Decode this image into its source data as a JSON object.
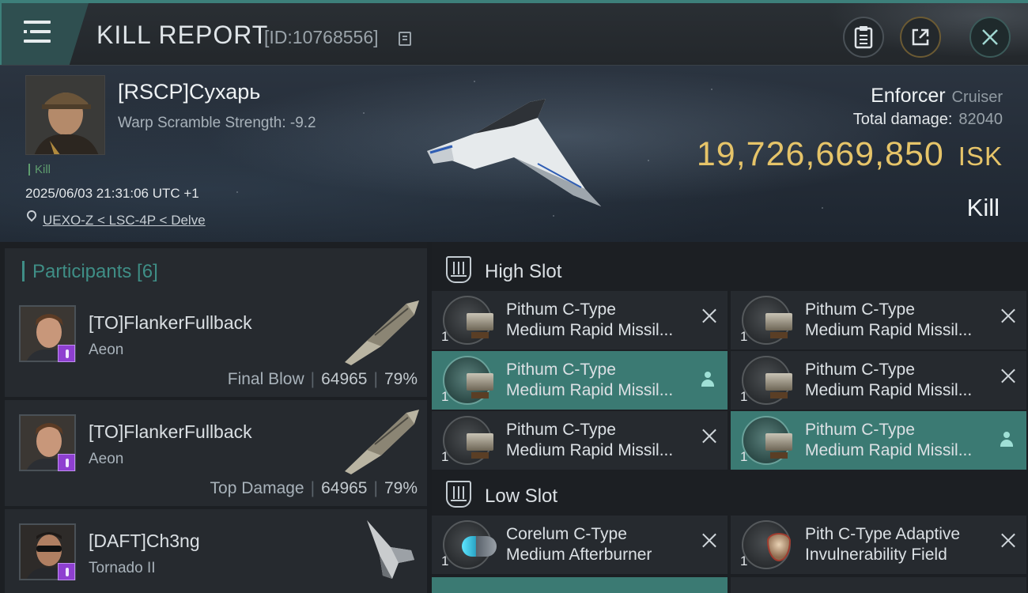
{
  "header": {
    "title": "KILL REPORT",
    "report_id": "[ID:10768556]"
  },
  "victim": {
    "name": "[RSCP]Сухарь",
    "warp_scramble": "Warp Scramble Strength: -9.2",
    "result_tag": "Kill",
    "datetime": "2025/06/03 21:31:06 UTC +1",
    "location": "UEXO-Z < LSC-4P < Delve",
    "ship_name": "Enforcer",
    "ship_class": "Cruiser",
    "total_damage_label": "Total damage:",
    "total_damage": "82040",
    "isk_value": "19,726,669,850",
    "isk_unit": "ISK",
    "outcome": "Kill"
  },
  "participants": {
    "title": "Participants [6]",
    "rows": [
      {
        "name": "[TO]FlankerFullback",
        "ship": "Aeon",
        "role": "Final Blow",
        "damage": "64965",
        "percent": "79%"
      },
      {
        "name": "[TO]FlankerFullback",
        "ship": "Aeon",
        "role": "Top Damage",
        "damage": "64965",
        "percent": "79%"
      },
      {
        "name": "[DAFT]Ch3ng",
        "ship": "Tornado II"
      }
    ]
  },
  "slots": {
    "high": {
      "title": "High Slot",
      "modules": [
        {
          "qty": "1",
          "line1": "Pithum C-Type",
          "line2": "Medium Rapid Missil...",
          "state": "destroyed"
        },
        {
          "qty": "1",
          "line1": "Pithum C-Type",
          "line2": "Medium Rapid Missil...",
          "state": "destroyed"
        },
        {
          "qty": "1",
          "line1": "Pithum C-Type",
          "line2": "Medium Rapid Missil...",
          "state": "dropped"
        },
        {
          "qty": "1",
          "line1": "Pithum C-Type",
          "line2": "Medium Rapid Missil...",
          "state": "destroyed"
        },
        {
          "qty": "1",
          "line1": "Pithum C-Type",
          "line2": "Medium Rapid Missil...",
          "state": "destroyed"
        },
        {
          "qty": "1",
          "line1": "Pithum C-Type",
          "line2": "Medium Rapid Missil...",
          "state": "dropped"
        }
      ]
    },
    "low": {
      "title": "Low Slot",
      "modules": [
        {
          "qty": "1",
          "line1": "Corelum C-Type",
          "line2": "Medium Afterburner",
          "state": "destroyed"
        },
        {
          "qty": "1",
          "line1": "Pith C-Type Adaptive",
          "line2": "Invulnerability Field",
          "state": "destroyed"
        }
      ]
    }
  },
  "colors": {
    "accent": "#3f8e86",
    "isk": "#e6c469",
    "highlight": "#3b7a73"
  },
  "icons": [
    "menu-icon",
    "copy-icon",
    "clipboard-icon",
    "export-icon",
    "close-icon",
    "location-pin-icon",
    "high-slot-icon",
    "low-slot-icon",
    "destroyed-x-icon",
    "dropped-person-icon"
  ]
}
